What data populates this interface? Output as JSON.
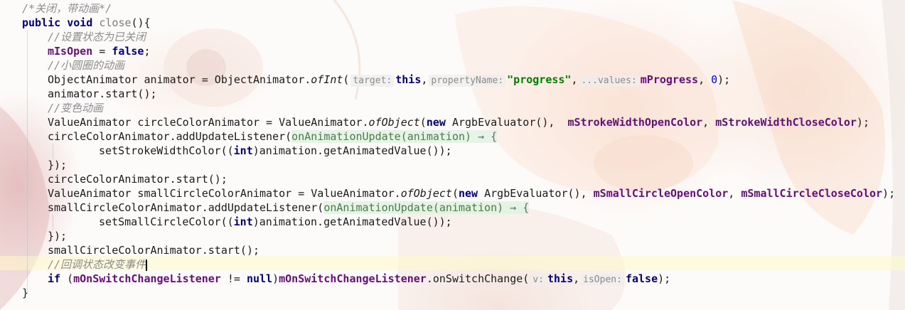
{
  "editor": {
    "lines": {
      "l1_comment": "/*关闭，带动画*/",
      "l2_public": "public",
      "l2_void": "void",
      "l2_method": "close",
      "l2_paren": "(){",
      "l3_comment": "//设置状态为已关闭",
      "l4_field": "mIsOpen",
      "l4_eq": " = ",
      "l4_false": "false",
      "l4_semi": ";",
      "l5_comment": "//小圆圈的动画",
      "l6_a": "ObjectAnimator animator = ObjectAnimator.",
      "l6_method": "ofInt",
      "l6_open": "(",
      "l6_hint_target": "target:",
      "l6_this": "this",
      "l6_comma1": ",",
      "l6_hint_prop": "propertyName:",
      "l6_str": "\"progress\"",
      "l6_comma2": ",",
      "l6_hint_values": "...values:",
      "l6_field": "mProgress",
      "l6_comma3": ", ",
      "l6_zero": "0",
      "l6_end": ");",
      "l7": "animator.start();",
      "l8_comment": "//变色动画",
      "l9_a": "ValueAnimator circleColorAnimator = ValueAnimator.",
      "l9_method": "ofObject",
      "l9_open": "(",
      "l9_new": "new",
      "l9_b": " ArgbEvaluator(),  ",
      "l9_f1": "mStrokeWidthOpenColor",
      "l9_comma": ", ",
      "l9_f2": "mStrokeWidthCloseColor",
      "l9_end": ");",
      "l10_a": "circleColorAnimator.addUpdateListener(",
      "l10_lambda": "onAnimationUpdate(animation)",
      "l10_arrow": " → {",
      "l11_a": "setStrokeWidthColor((",
      "l11_int": "int",
      "l11_b": ")animation.getAnimatedValue());",
      "l12": "});",
      "l13": "circleColorAnimator.start();",
      "l14_a": "ValueAnimator smallCircleColorAnimator = ValueAnimator.",
      "l14_method": "ofObject",
      "l14_open": "(",
      "l14_new": "new",
      "l14_b": " ArgbEvaluator(), ",
      "l14_f1": "mSmallCircleOpenColor",
      "l14_comma": ", ",
      "l14_f2": "mSmallCircleCloseColor",
      "l14_end": ");",
      "l15_a": "smallCircleColorAnimator.addUpdateListener(",
      "l15_lambda": "onAnimationUpdate(animation)",
      "l15_arrow": " → {",
      "l16_a": "setSmallCircleColor((",
      "l16_int": "int",
      "l16_b": ")animation.getAnimatedValue());",
      "l17": "});",
      "l18": "smallCircleColorAnimator.start();",
      "l19_comment": "//回调状态改变事件",
      "l20_if": "if",
      "l20_a": " (",
      "l20_f1": "mOnSwitchChangeListener",
      "l20_ne": " != ",
      "l20_null": "null",
      "l20_b": ")",
      "l20_f2": "mOnSwitchChangeListener",
      "l20_c": ".onSwitchChange(",
      "l20_hint_v": "v:",
      "l20_this": "this",
      "l20_comma": ",",
      "l20_hint_open": "isOpen:",
      "l20_false": "false",
      "l20_end": ");",
      "l21": "}"
    }
  },
  "colors": {
    "comment": "#8c8c8c",
    "keyword": "#000080",
    "field": "#660e7a",
    "string": "#008000",
    "number": "#0000ff",
    "caret_line": "#fffac8"
  }
}
